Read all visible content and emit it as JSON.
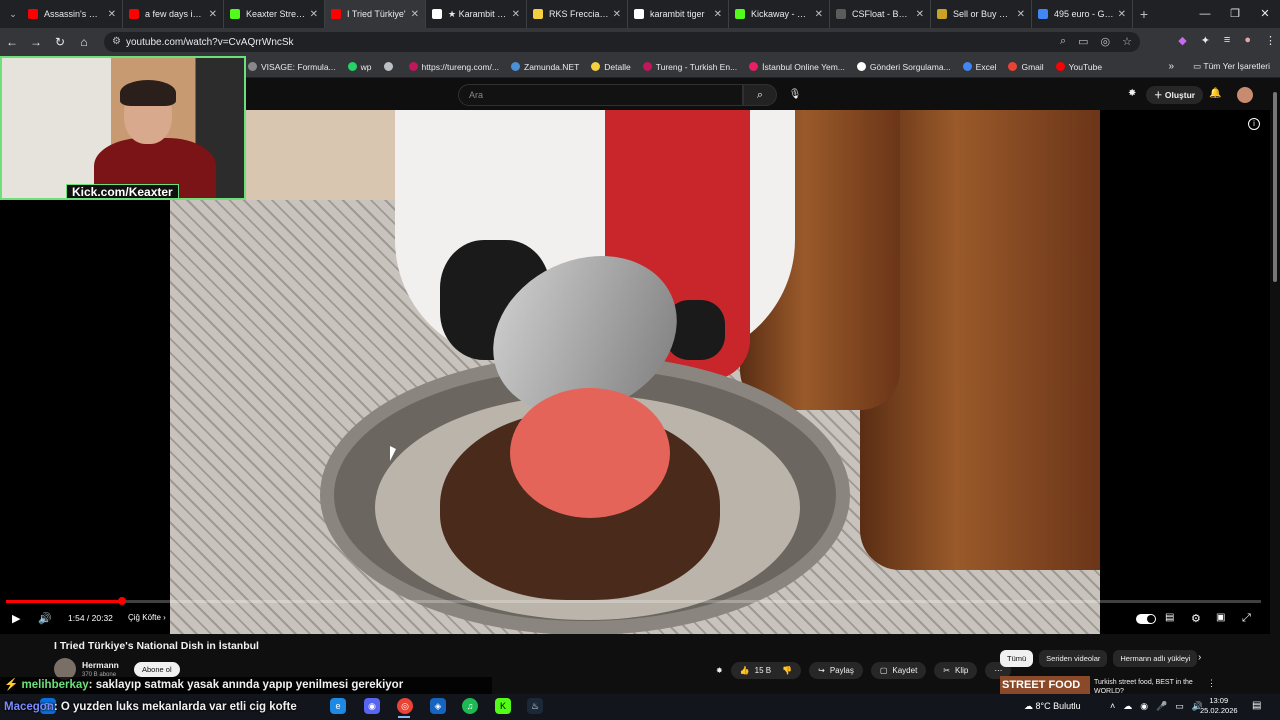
{
  "tabs": [
    {
      "label": "Assassin's Creed",
      "color": "#ff0000"
    },
    {
      "label": "a few days in ls",
      "color": "#ff0000"
    },
    {
      "label": "Keaxter Stream",
      "color": "#53fc18"
    },
    {
      "label": "I Tried Türkiye'",
      "color": "#ff0000",
      "active": true
    },
    {
      "label": "★ Karambit | U",
      "color": "#ffffff"
    },
    {
      "label": "RKS Freccia 15",
      "color": "#f4d03f"
    },
    {
      "label": "karambit tiger",
      "color": "#ffffff"
    },
    {
      "label": "Kickaway - Kick",
      "color": "#53fc18"
    },
    {
      "label": "CSFloat - Buy &",
      "color": "#5b5b5b"
    },
    {
      "label": "Sell or Buy ★ In",
      "color": "#c9a227"
    },
    {
      "label": "495 euro - Goo",
      "color": "#4285f4"
    }
  ],
  "browser": {
    "url": "youtube.com/watch?v=CvAQrrWncSk",
    "bookmarks": [
      {
        "label": "VISAGE: Formula...",
        "color": "#888888"
      },
      {
        "label": "wp",
        "color": "#25d366"
      },
      {
        "label": "",
        "color": "#bdc1c6"
      },
      {
        "label": "https://tureng.com/...",
        "color": "#c2185b"
      },
      {
        "label": "Zamunda.NET",
        "color": "#4a90d9"
      },
      {
        "label": "Detalle",
        "color": "#f4d03f"
      },
      {
        "label": "Tureng - Turkish En...",
        "color": "#c2185b"
      },
      {
        "label": "İstanbul Online Yem...",
        "color": "#e91e63"
      },
      {
        "label": "Gönderi Sorgulama...",
        "color": "#ffffff"
      },
      {
        "label": "Excel",
        "color": "#4285f4"
      },
      {
        "label": "Gmail",
        "color": "#ea4335"
      },
      {
        "label": "YouTube",
        "color": "#ff0000"
      }
    ],
    "bookmarks_all": "Tüm Yer İşaretleri"
  },
  "youtube": {
    "search_placeholder": "Ara",
    "create_label": "Oluştur"
  },
  "webcam": {
    "overlay_text": "Kick.com/Keaxter"
  },
  "player": {
    "time": "1:54 / 20:32",
    "chapter": "Çiğ Köfte",
    "progress": 0.0925,
    "watermark": "subscribe"
  },
  "video": {
    "title": "I Tried Türkiye's National Dish in İstanbul",
    "channel": "Hermann",
    "subscribers": "370 B abone",
    "subscribe_label": "Abone ol",
    "likes": "15 B",
    "share_label": "Paylaş",
    "save_label": "Kaydet",
    "clip_label": "Klip"
  },
  "recommendations": {
    "chips": [
      "Tümü",
      "Seriden videolar",
      "Hermann adlı yükleyi"
    ],
    "first_thumb_text": "STREET FOOD",
    "first_title": "Turkish street food, BEST in the WORLD?"
  },
  "chat": [
    {
      "user": "melihberkay",
      "message": " saklayıp satmak yasak anında yapıp yenilmesi gerekiyor"
    },
    {
      "user": "Macegon",
      "message": " O yuzden luks mekanlarda var etli cig kofte"
    }
  ],
  "taskbar": {
    "weather": "8°C  Bulutlu",
    "time": "13:09",
    "date": "25.02.2026"
  }
}
